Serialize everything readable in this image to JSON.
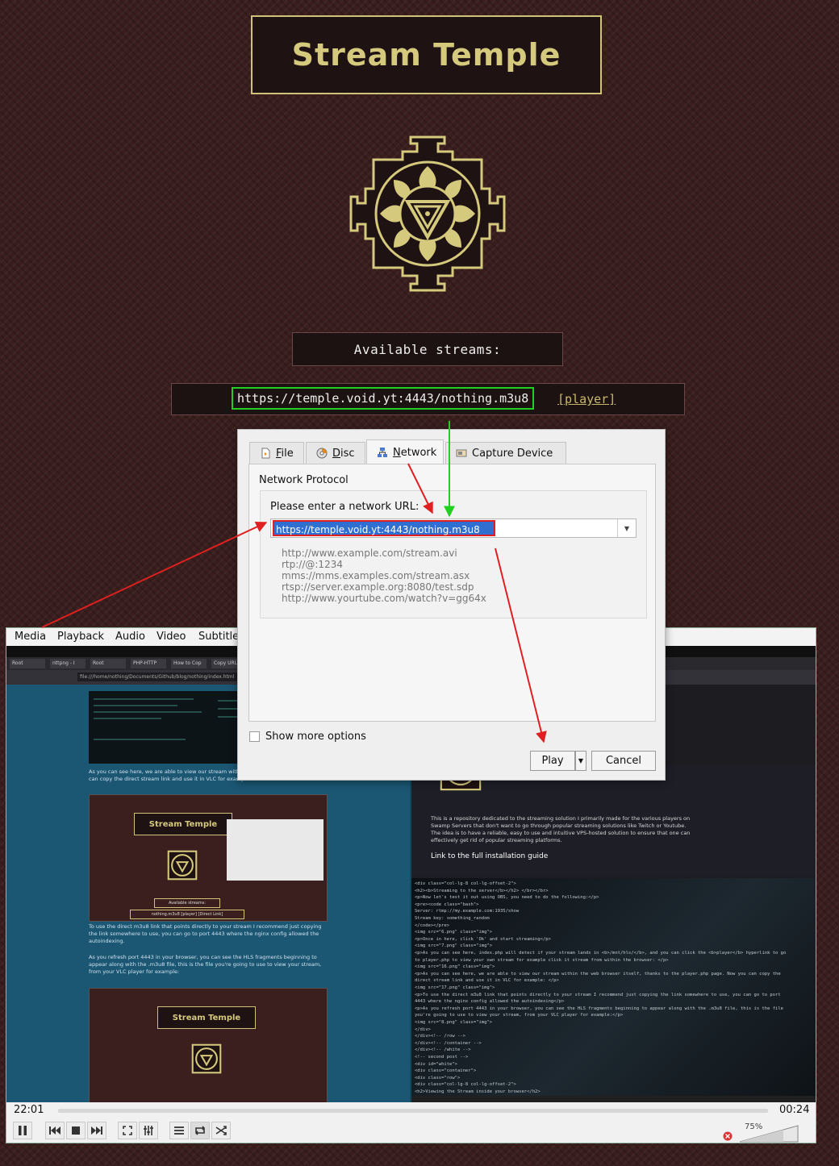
{
  "page": {
    "title": "Stream Temple",
    "streams_heading": "Available streams:",
    "stream_url": "https://temple.void.yt:4443/nothing.m3u8",
    "player_link": "[player]"
  },
  "colors": {
    "background": "#3a1e1e",
    "gold": "#d4c97c",
    "highlight_green": "#22d022",
    "arrow_red": "#e02020",
    "selection_blue": "#2f6fd1"
  },
  "vlc": {
    "menu": [
      "Media",
      "Playback",
      "Audio",
      "Video",
      "Subtitle"
    ],
    "time_elapsed": "22:01",
    "time_total": "00:24",
    "volume": "75%",
    "controls": [
      "pause-icon",
      "previous-icon",
      "stop-icon",
      "next-icon",
      "fullscreen-icon",
      "equalizer-icon",
      "playlist-icon",
      "loop-icon",
      "shuffle-icon"
    ],
    "video": {
      "thumb_title": "Stream Temple",
      "thumb_streams": "Available streams:",
      "thumb_stream": "nothing.m3u8  [player]  [Direct Link]",
      "blog_para_1": "As you can see here, we are able to view our stream within the player.php page. Now you can copy the direct stream link and use it in VLC for example:",
      "blog_para_2": "To use the direct m3u8 link that points directly to your stream I recommend just copying the link somewhere to use, you can go to port 4443 where the nginx config allowed the autoindexing.",
      "blog_para_3": "As you refresh port 4443 in your browser, you can see the HLS fragments beginning to appear along with the .m3u8 file, this is the file you're going to use to view your stream, from your VLC player for example:",
      "right_para": "This is a repository dedicated to the streaming solution I primarily made for the various players on Swamp Servers that don't want to go through popular streaming solutions like Twitch or Youtube. The idea is to have a reliable, easy to use and intuitive VPS-hosted solution to ensure that one can effectively get rid of popular streaming platforms.",
      "guide_link": "Link to the full installation guide",
      "tabs": [
        "Root",
        "nttpng - I",
        "Root",
        "PHP-HTTP",
        "How to Cop",
        "Copy URL"
      ],
      "address": "file:///home/nothing/Documents/Github/blog/nothing/index.html",
      "code_lines": [
        "<div class=\"col-lg-8 col-lg-offset-2\">",
        "<h2><b>Streaming to the server</b></h2> </br></br>",
        "<p>Now let's test it out using OBS, you need to do the following:</p>",
        "<pre><code class=\"bash\">",
        "Server:        rtmp://my.example.com:1935/show",
        "Stream key:    something_random",
        "</code></pre>",
        "<img src=\"6.png\" class=\"img\">",
        "<p>Once in here, click 'Ok' and start streaming</p>",
        "<img src=\"7.png\" class=\"img\">",
        "<p>As you can see here, index.php will detect if your stream lands in <b>/mnt/hls/</b>, and you can click the <b>player</b> hyperlink to go",
        "to player.php to view your own stream for example click it stream from within the browser: </p>",
        "<img src=\"16.png\" class=\"img\">",
        "<p>As you can see here, we are able to view our stream within the web browser itself, thanks to the player.php page. Now you can copy the",
        "direct stream link and use it in VLC for example: </p>",
        "<img src=\"17.png\" class=\"img\">",
        "<p>To use the direct m3u8 link that points directly to your stream I recommend just copying the link somewhere to use, you can go to port",
        "4443 where the nginx config allowed the autoindexing</p>",
        "<p>As you refresh port 4443 in your browser, you can see the HLS fragments beginning to appear along with the .m3u8 file, this is the file",
        "you're going to use to view your stream, from your VLC player for example:</p>",
        "<img src=\"8.png\" class=\"img\">",
        "</div>",
        "</div><!-- /row -->",
        "</div><!-- /container -->",
        "</div><!-- /white -->",
        "<!-- second post -->",
        "<div id=\"white\">",
        "<div class=\"container\">",
        "<div class=\"row\">",
        "<div class=\"col-lg-8 col-lg-offset-2\">",
        "<h2>Viewing the Stream inside your browser</h2>"
      ]
    }
  },
  "dialog": {
    "tabs": [
      {
        "label": "File",
        "mnemonic": "F",
        "rest": "ile"
      },
      {
        "label": "Disc",
        "mnemonic": "D",
        "rest": "isc"
      },
      {
        "label": "Network",
        "mnemonic": "N",
        "rest": "etwork"
      },
      {
        "label": "Capture Device",
        "mnemonic": "",
        "rest": ""
      }
    ],
    "active_tab": "Network",
    "group_title": "Network Protocol",
    "url_prompt": "Please enter a network URL:",
    "url_value": "https://temple.void.yt:4443/nothing.m3u8",
    "examples": [
      "http://www.example.com/stream.avi",
      "rtp://@:1234",
      "mms://mms.examples.com/stream.asx",
      "rtsp://server.example.org:8080/test.sdp",
      "http://www.yourtube.com/watch?v=gg64x"
    ],
    "show_more": "Show more options",
    "play": "Play",
    "cancel": "Cancel"
  }
}
